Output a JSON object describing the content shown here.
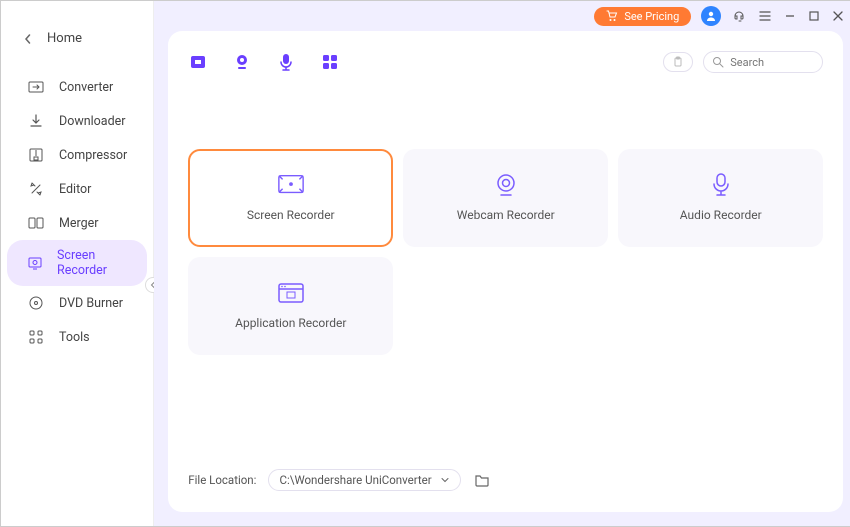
{
  "header": {
    "home_label": "Home",
    "pricing_label": "See Pricing"
  },
  "sidebar": {
    "items": [
      {
        "label": "Converter"
      },
      {
        "label": "Downloader"
      },
      {
        "label": "Compressor"
      },
      {
        "label": "Editor"
      },
      {
        "label": "Merger"
      },
      {
        "label": "Screen Recorder"
      },
      {
        "label": "DVD Burner"
      },
      {
        "label": "Tools"
      }
    ]
  },
  "search": {
    "placeholder": "Search"
  },
  "tiles": [
    {
      "label": "Screen Recorder"
    },
    {
      "label": "Webcam Recorder"
    },
    {
      "label": "Audio Recorder"
    },
    {
      "label": "Application Recorder"
    }
  ],
  "footer": {
    "label": "File Location:",
    "path": "C:\\Wondershare UniConverter"
  }
}
